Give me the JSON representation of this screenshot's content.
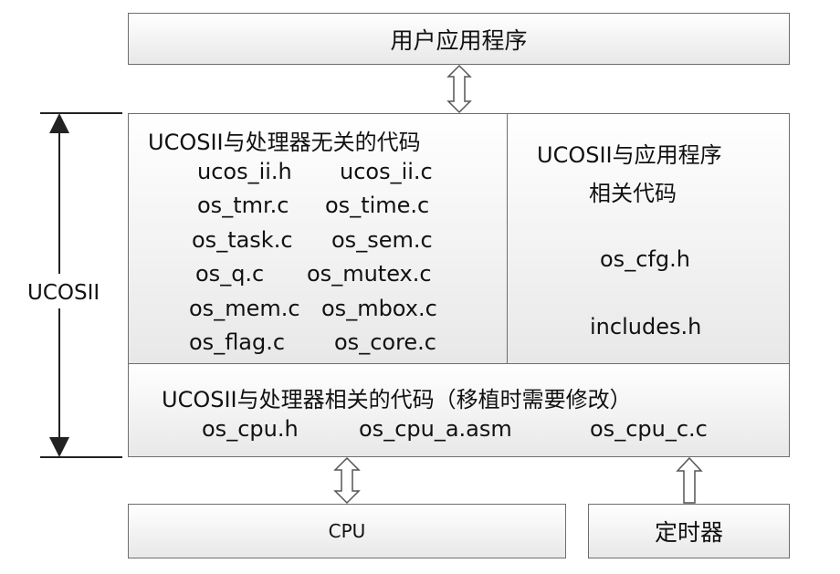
{
  "user_app": "用户应用程序",
  "ucosii_label": "UCOSII",
  "independent": {
    "title": "UCOSII与处理器无关的代码",
    "files": [
      [
        "ucos_ii.h",
        "ucos_ii.c"
      ],
      [
        "os_tmr.c",
        "os_time.c"
      ],
      [
        "os_task.c",
        "os_sem.c"
      ],
      [
        "os_q.c",
        "os_mutex.c"
      ],
      [
        "os_mem.c",
        "os_mbox.c"
      ],
      [
        "os_flag.c",
        "os_core.c"
      ]
    ]
  },
  "app_related": {
    "title_line1": "UCOSII与应用程序",
    "title_line2": "相关代码",
    "files": [
      "os_cfg.h",
      "includes.h"
    ]
  },
  "cpu_related": {
    "title": "UCOSII与处理器相关的代码（移植时需要修改）",
    "files": [
      "os_cpu.h",
      "os_cpu_a.asm",
      "os_cpu_c.c"
    ]
  },
  "cpu_box": "CPU",
  "timer_box": "定时器"
}
